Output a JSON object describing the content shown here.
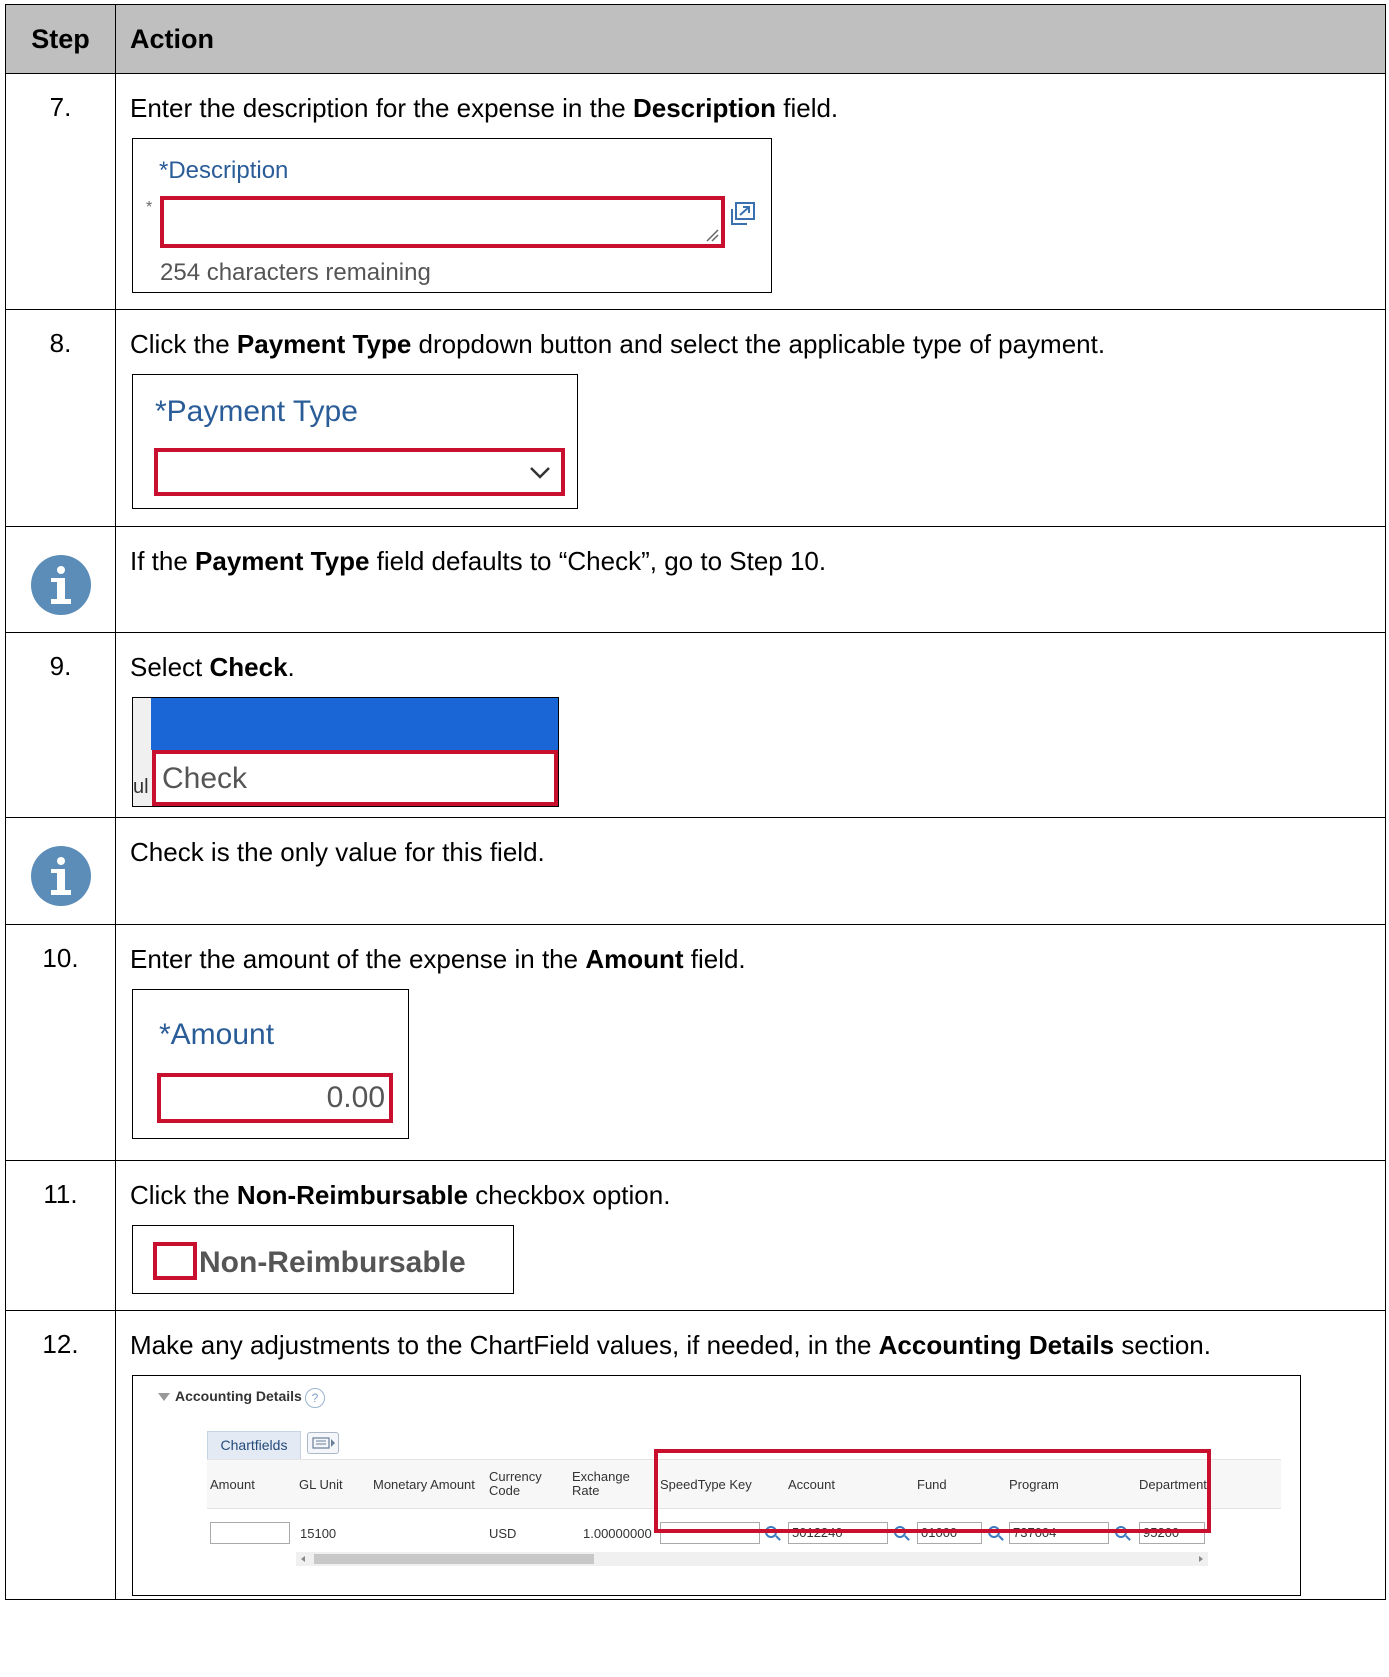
{
  "table": {
    "header": {
      "step": "Step",
      "action": "Action"
    }
  },
  "rows": {
    "r7": {
      "num": "7.",
      "pre": "Enter the description for the expense in the ",
      "bold": "Description",
      "post": " field.",
      "shot": {
        "label": "*Description",
        "required_mark": "*",
        "counter": "254 characters remaining"
      }
    },
    "r8": {
      "num": "8.",
      "pre": "Click the ",
      "bold": "Payment Type",
      "post": " dropdown button and select the applicable type of payment.",
      "shot": {
        "label": "*Payment Type"
      }
    },
    "info1": {
      "pre": "If the ",
      "bold": "Payment Type",
      "post": " field defaults to “Check”, go to Step 10."
    },
    "r9": {
      "num": "9.",
      "pre": "Select ",
      "bold": "Check",
      "post": ".",
      "shot": {
        "option": "Check",
        "partial": "ul"
      }
    },
    "info2": {
      "text": "Check is the only value for this field."
    },
    "r10": {
      "num": "10.",
      "pre": "Enter the amount of the expense in the ",
      "bold": "Amount",
      "post": " field.",
      "shot": {
        "label": "*Amount",
        "value": "0.00"
      }
    },
    "r11": {
      "num": "11.",
      "pre": "Click the ",
      "bold": "Non-Reimbursable",
      "post": " checkbox option.",
      "shot": {
        "label": "Non-Reimbursable"
      }
    },
    "r12": {
      "num": "12.",
      "pre": "Make any adjustments to the ChartField values, if needed, in the ",
      "bold": "Accounting Details",
      "post": " section.",
      "shot": {
        "section": "Accounting Details",
        "help": "?",
        "tab": "Chartfields",
        "columns": {
          "amount": "Amount",
          "gl_unit": "GL Unit",
          "monetary": "Monetary Amount",
          "currency": "Currency Code",
          "exchange": "Exchange Rate",
          "speedtype": "SpeedType Key",
          "account": "Account",
          "fund": "Fund",
          "program": "Program",
          "department": "Department"
        },
        "values": {
          "gl_unit": "15100",
          "currency": "USD",
          "exchange": "1.00000000",
          "account": "5012240",
          "fund": "01000",
          "program": "737004",
          "department": "95200"
        }
      }
    }
  },
  "colors": {
    "highlight": "#c8102e",
    "header_bg": "#bfbfbf",
    "info_icon": "#5b8db8",
    "selected_bg": "#1a66d6"
  }
}
